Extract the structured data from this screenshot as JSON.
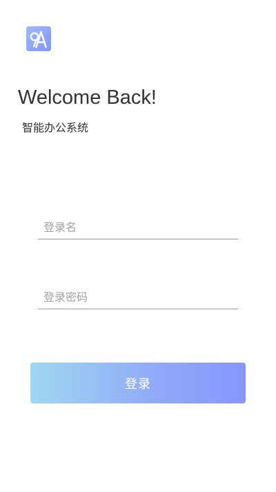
{
  "app": {
    "logo_icon": "app-logo-icon",
    "logo_text": "A"
  },
  "header": {
    "title": "Welcome Back!",
    "subtitle": "智能办公系统"
  },
  "form": {
    "username": {
      "placeholder": "登录名",
      "value": ""
    },
    "password": {
      "placeholder": "登录密码",
      "value": ""
    },
    "login_label": "登录"
  },
  "colors": {
    "accent_start": "#9fd7f1",
    "accent_end": "#8796ff",
    "logo_bg": "#8fa7ff",
    "text": "#333333",
    "placeholder": "#a3a3a3",
    "underline": "#9a9a9a"
  }
}
